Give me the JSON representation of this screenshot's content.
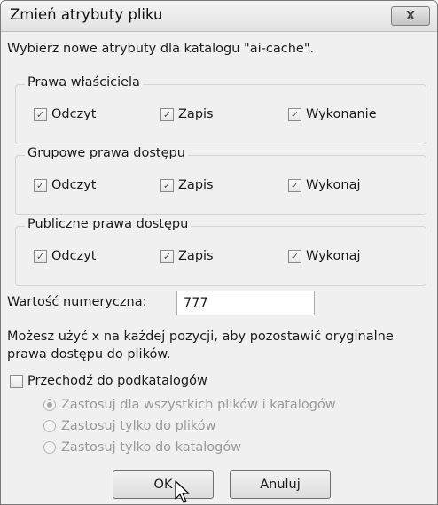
{
  "dialog": {
    "title": "Zmień atrybuty pliku",
    "close_label": "X",
    "description": "Wybierz nowe atrybuty dla katalogu \"ai-cache\"."
  },
  "groups": [
    {
      "title": "Prawa właściciela",
      "checkboxes": [
        {
          "label": "Odczyt",
          "checked": true
        },
        {
          "label": "Zapis",
          "checked": true
        },
        {
          "label": "Wykonanie",
          "checked": true
        }
      ]
    },
    {
      "title": "Grupowe prawa dostępu",
      "checkboxes": [
        {
          "label": "Odczyt",
          "checked": true
        },
        {
          "label": "Zapis",
          "checked": true
        },
        {
          "label": "Wykonaj",
          "checked": true
        }
      ]
    },
    {
      "title": "Publiczne prawa dostępu",
      "checkboxes": [
        {
          "label": "Odczyt",
          "checked": true
        },
        {
          "label": "Zapis",
          "checked": true
        },
        {
          "label": "Wykonaj",
          "checked": true
        }
      ]
    }
  ],
  "numeric": {
    "label": "Wartość numeryczna:",
    "value": "777"
  },
  "hint": {
    "line1": "Możesz użyć x na każdej pozycji, aby pozostawić oryginalne",
    "line2": "prawa dostępu do plików."
  },
  "recurse": {
    "label": "Przechodź do podkatalogów",
    "checked": false
  },
  "radios": [
    {
      "label": "Zastosuj dla wszystkich plików i katalogów",
      "selected": true
    },
    {
      "label": "Zastosuj tylko do plików",
      "selected": false
    },
    {
      "label": "Zastosuj tylko do katalogów",
      "selected": false
    }
  ],
  "buttons": {
    "ok": "OK",
    "cancel": "Anuluj"
  }
}
